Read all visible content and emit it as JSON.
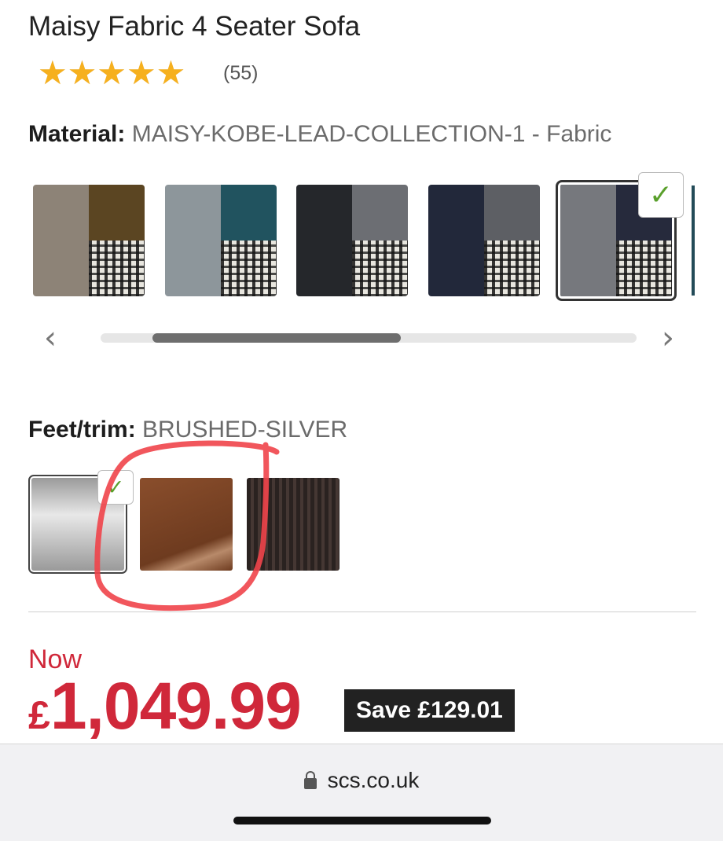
{
  "product": {
    "title": "Maisy Fabric 4 Seater Sofa",
    "rating": {
      "stars": 4.5,
      "max": 5,
      "count_label": "(55)"
    }
  },
  "material": {
    "key": "Material:",
    "value": "MAISY-KOBE-LEAD-COLLECTION-1 - Fabric",
    "selected_index": 4,
    "swatches": [
      {
        "colors": [
          "#8d8377",
          "#5b4522"
        ]
      },
      {
        "colors": [
          "#8d969b",
          "#21535f"
        ]
      },
      {
        "colors": [
          "#25272b",
          "#6c6e73"
        ]
      },
      {
        "colors": [
          "#22283a",
          "#5d5f64"
        ]
      },
      {
        "colors": [
          "#76787d",
          "#262a3c"
        ]
      }
    ],
    "prev_icon": "chevron-left-icon",
    "next_icon": "chevron-right-icon",
    "scroll_position": 0.18
  },
  "trim": {
    "key": "Feet/trim:",
    "value": "BRUSHED-SILVER",
    "selected_index": 0,
    "options": [
      {
        "colors": [
          "#9a9a9a",
          "#e8e8e8"
        ]
      },
      {
        "colors": [
          "#8a4e2c",
          "#6e3b1f"
        ]
      },
      {
        "colors": [
          "#2a2220",
          "#453733"
        ]
      }
    ],
    "annotation_color": "#f0444a"
  },
  "pricing": {
    "now_label": "Now",
    "currency": "£",
    "amount": "1,049.99",
    "save_label": "Save £129.01",
    "price_color": "#d0283a"
  },
  "browser": {
    "url": "scs.co.uk",
    "lock_icon": "lock-icon"
  }
}
